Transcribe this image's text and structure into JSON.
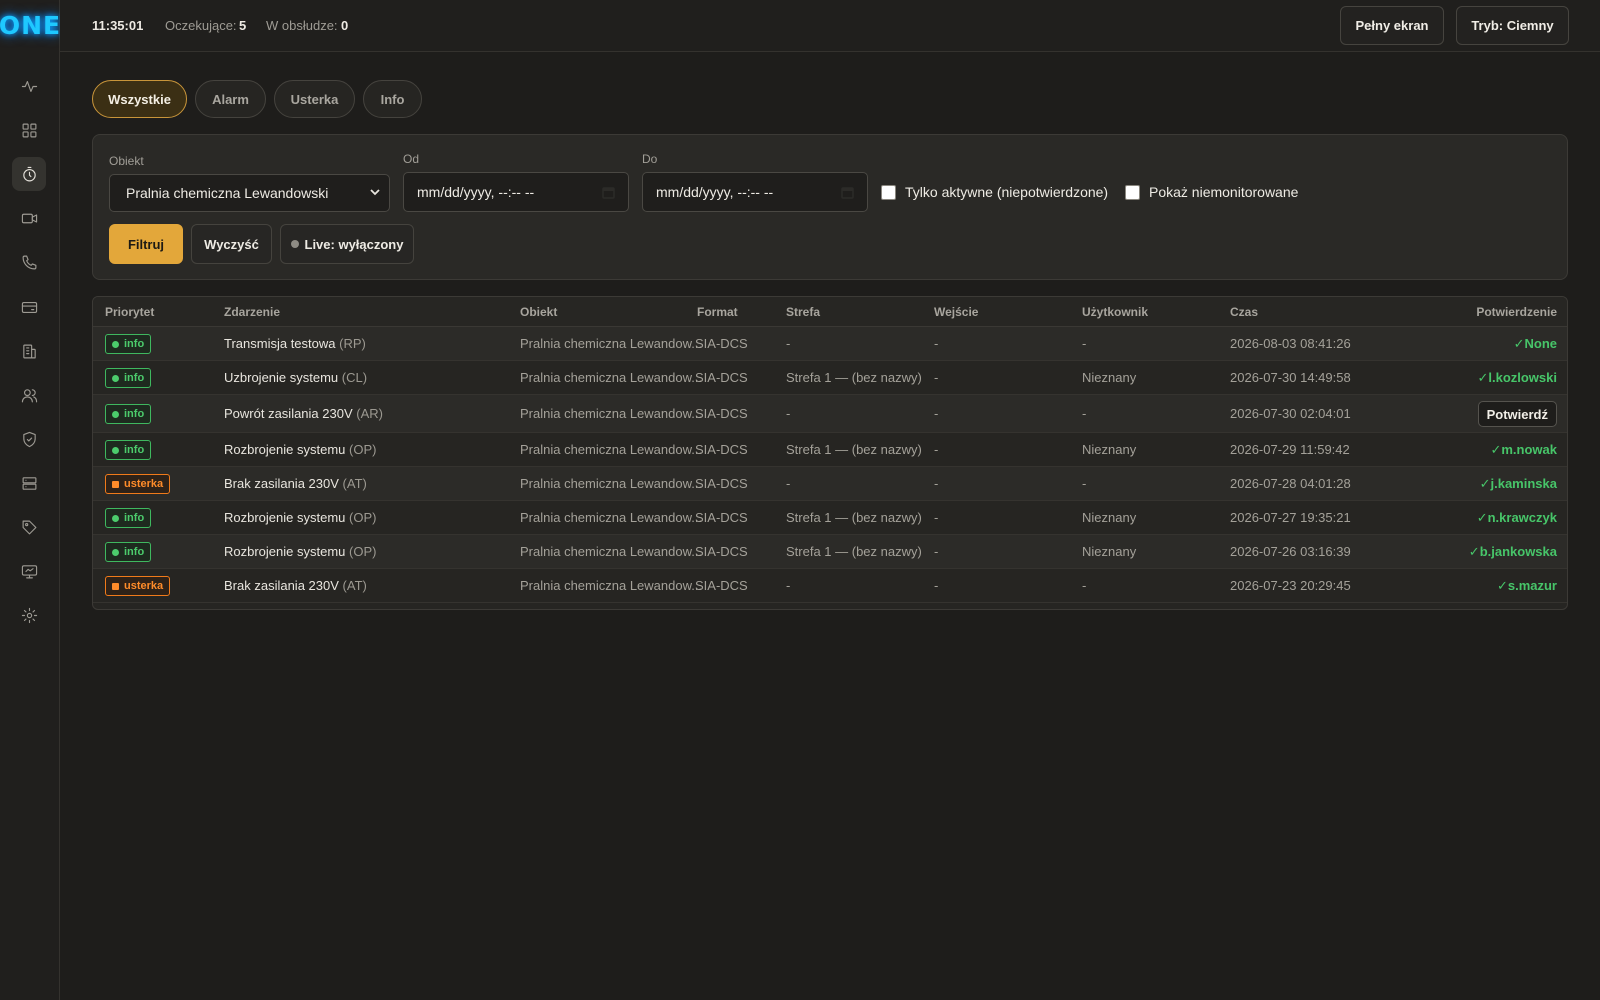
{
  "app": {
    "logo": "ONE"
  },
  "sidebar": {
    "items": [
      {
        "icon": "activity-icon",
        "name": "nav-activity"
      },
      {
        "icon": "grid-icon",
        "name": "nav-dashboard"
      },
      {
        "icon": "timer-icon",
        "name": "nav-events",
        "active": true
      },
      {
        "icon": "video-icon",
        "name": "nav-cameras"
      },
      {
        "icon": "phone-icon",
        "name": "nav-calls"
      },
      {
        "icon": "card-icon",
        "name": "nav-cards"
      },
      {
        "icon": "building-icon",
        "name": "nav-objects"
      },
      {
        "icon": "users-icon",
        "name": "nav-users"
      },
      {
        "icon": "shield-icon",
        "name": "nav-security"
      },
      {
        "icon": "server-icon",
        "name": "nav-servers"
      },
      {
        "icon": "tag-icon",
        "name": "nav-tags"
      },
      {
        "icon": "monitor-icon",
        "name": "nav-monitor"
      },
      {
        "icon": "gear-icon",
        "name": "nav-settings"
      }
    ]
  },
  "topbar": {
    "time": "11:35:01",
    "pending_label": "Oczekujące:",
    "pending_value": "5",
    "in_service_label": "W obsłudze:",
    "in_service_value": "0",
    "fullscreen_label": "Pełny ekran",
    "theme_label": "Tryb: Ciemny"
  },
  "tabs": [
    {
      "label": "Wszystkie",
      "active": true
    },
    {
      "label": "Alarm"
    },
    {
      "label": "Usterka"
    },
    {
      "label": "Info"
    }
  ],
  "filters": {
    "object_label": "Obiekt",
    "object_value": "Pralnia chemiczna Lewandowski",
    "from_label": "Od",
    "from_placeholder": "mm/dd/yyyy, --:-- --",
    "to_label": "Do",
    "to_placeholder": "mm/dd/yyyy, --:-- --",
    "only_active_label": "Tylko aktywne (niepotwierdzone)",
    "show_unmonitored_label": "Pokaż niemonitorowane",
    "filter_button": "Filtruj",
    "clear_button": "Wyczyść",
    "live_button": "Live: wyłączony"
  },
  "table": {
    "headers": [
      "Priorytet",
      "Zdarzenie",
      "Obiekt",
      "Format",
      "Strefa",
      "Wejście",
      "Użytkownik",
      "Czas",
      "Potwierdzenie"
    ],
    "rows": [
      {
        "priority": "info",
        "kind": "info",
        "event": "Transmisja testowa",
        "code": "(RP)",
        "object": "Pralnia chemiczna Lewandow...",
        "format": "SIA-DCS",
        "zone": "-",
        "input": "-",
        "user": "-",
        "time": "2026-08-03 08:41:26",
        "ack": "✓None",
        "ack_button": false
      },
      {
        "priority": "info",
        "kind": "info",
        "event": "Uzbrojenie systemu",
        "code": "(CL)",
        "object": "Pralnia chemiczna Lewandow...",
        "format": "SIA-DCS",
        "zone": "Strefa 1 — (bez nazwy)",
        "input": "-",
        "user": "Nieznany",
        "time": "2026-07-30 14:49:58",
        "ack": "✓l.kozlowski",
        "ack_button": false
      },
      {
        "priority": "info",
        "kind": "info",
        "event": "Powrót zasilania 230V",
        "code": "(AR)",
        "object": "Pralnia chemiczna Lewandow...",
        "format": "SIA-DCS",
        "zone": "-",
        "input": "-",
        "user": "-",
        "time": "2026-07-30 02:04:01",
        "ack": "Potwierdź",
        "ack_button": true
      },
      {
        "priority": "info",
        "kind": "info",
        "event": "Rozbrojenie systemu",
        "code": "(OP)",
        "object": "Pralnia chemiczna Lewandow...",
        "format": "SIA-DCS",
        "zone": "Strefa 1 — (bez nazwy)",
        "input": "-",
        "user": "Nieznany",
        "time": "2026-07-29 11:59:42",
        "ack": "✓m.nowak",
        "ack_button": false
      },
      {
        "priority": "usterka",
        "kind": "warn",
        "event": "Brak zasilania 230V",
        "code": "(AT)",
        "object": "Pralnia chemiczna Lewandow...",
        "format": "SIA-DCS",
        "zone": "-",
        "input": "-",
        "user": "-",
        "time": "2026-07-28 04:01:28",
        "ack": "✓j.kaminska",
        "ack_button": false
      },
      {
        "priority": "info",
        "kind": "info",
        "event": "Rozbrojenie systemu",
        "code": "(OP)",
        "object": "Pralnia chemiczna Lewandow...",
        "format": "SIA-DCS",
        "zone": "Strefa 1 — (bez nazwy)",
        "input": "-",
        "user": "Nieznany",
        "time": "2026-07-27 19:35:21",
        "ack": "✓n.krawczyk",
        "ack_button": false
      },
      {
        "priority": "info",
        "kind": "info",
        "event": "Rozbrojenie systemu",
        "code": "(OP)",
        "object": "Pralnia chemiczna Lewandow...",
        "format": "SIA-DCS",
        "zone": "Strefa 1 — (bez nazwy)",
        "input": "-",
        "user": "Nieznany",
        "time": "2026-07-26 03:16:39",
        "ack": "✓b.jankowska",
        "ack_button": false
      },
      {
        "priority": "usterka",
        "kind": "warn",
        "event": "Brak zasilania 230V",
        "code": "(AT)",
        "object": "Pralnia chemiczna Lewandow...",
        "format": "SIA-DCS",
        "zone": "-",
        "input": "-",
        "user": "-",
        "time": "2026-07-23 20:29:45",
        "ack": "✓s.mazur",
        "ack_button": false
      }
    ]
  },
  "colors": {
    "accent": "#e3a73a",
    "info_green": "#4ccc6c",
    "warn_orange": "#ff8c2a",
    "logo_cyan": "#1ec8ff"
  }
}
